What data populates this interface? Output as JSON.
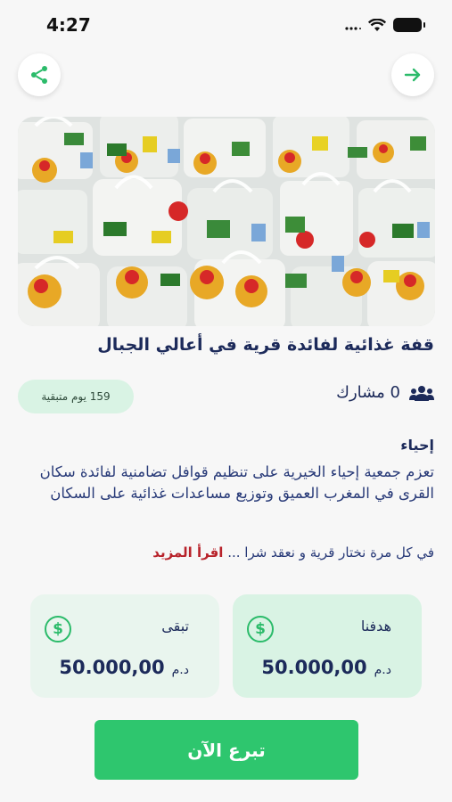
{
  "status_bar": {
    "time": "4:27"
  },
  "header": {
    "share_icon": "share-icon",
    "next_icon": "arrow-right-icon"
  },
  "campaign": {
    "title": "قفة غذائية لفائدة قرية في أعالي الجبال",
    "participants": "0 مشارك",
    "days_left": "159 يوم متبقية",
    "organization": "إحياء",
    "description": "تعزم جمعية إحياء الخيرية على تنظيم قوافل تضامنية لفائدة سكان القرى في المغرب العميق وتوزيع مساعدات غذائية على السكان",
    "teaser": "في كل مرة نختار قرية و نعقد شرا ...",
    "read_more": "اقرأ المزيد"
  },
  "stats": {
    "goal": {
      "label": "هدفنا",
      "amount": "50.000,00",
      "currency": "د.م"
    },
    "remaining": {
      "label": "تبقى",
      "amount": "50.000,00",
      "currency": "د.م"
    }
  },
  "actions": {
    "donate_label": "تبرع الآن"
  },
  "colors": {
    "accent": "#2ec66e",
    "navy": "#1c2a5a",
    "read_more": "#b8232b",
    "pill": "#d9f3e4"
  }
}
